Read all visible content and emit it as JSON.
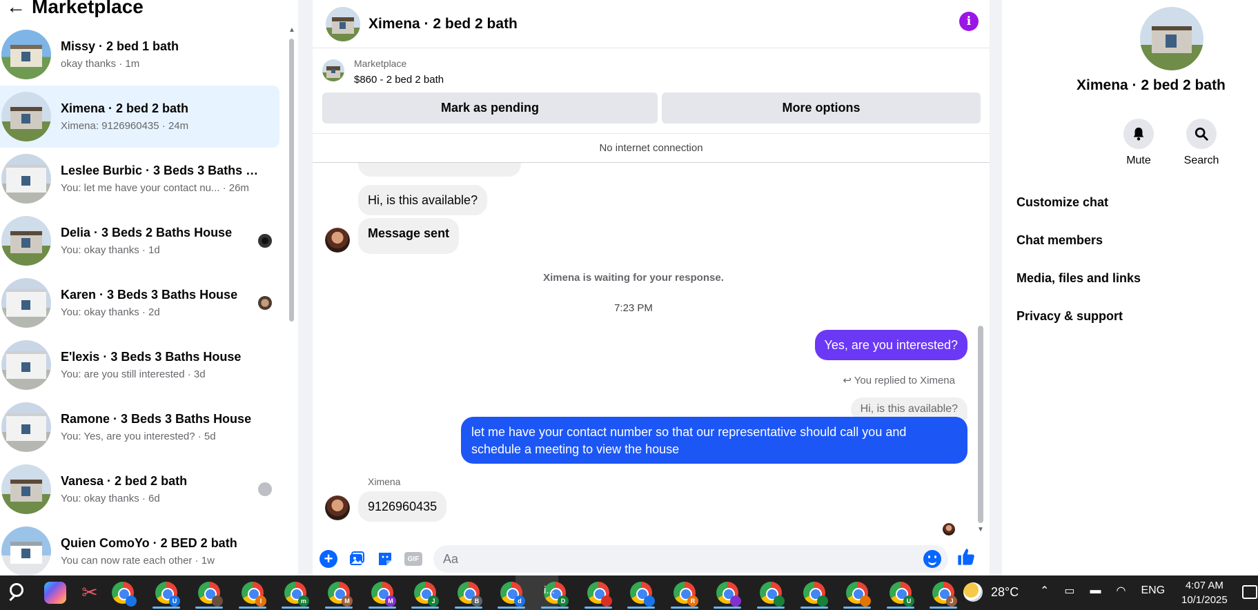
{
  "sidebar": {
    "back_glyph": "←",
    "title": "Marketplace",
    "conversations": [
      {
        "name": "Missy · 2 bed 1 bath",
        "preview": "okay thanks · 1m",
        "active": false
      },
      {
        "name": "Ximena · 2 bed 2 bath",
        "preview": "Ximena: 9126960435 · 24m",
        "active": true
      },
      {
        "name": "Leslee Burbic · 3 Beds 3 Baths H...",
        "preview": "You: let me have your contact nu... · 26m",
        "active": false
      },
      {
        "name": "Delia · 3 Beds 2 Baths House",
        "preview": "You: okay thanks · 1d",
        "active": false
      },
      {
        "name": "Karen · 3 Beds 3 Baths House",
        "preview": "You: okay thanks · 2d",
        "active": false
      },
      {
        "name": "E'lexis · 3 Beds 3 Baths House",
        "preview": "You: are you still interested · 3d",
        "active": false
      },
      {
        "name": "Ramone · 3 Beds 3 Baths House",
        "preview": "You: Yes, are you interested? · 5d",
        "active": false
      },
      {
        "name": "Vanesa · 2 bed 2 bath",
        "preview": "You: okay thanks · 6d",
        "active": false
      },
      {
        "name": "Quien ComoYo · 2 BED 2 bath",
        "preview": "You can now rate each other · 1w",
        "active": false
      }
    ]
  },
  "chat": {
    "header_title": "Ximena · 2 bed 2 bath",
    "info_glyph": "i",
    "marketplace_label": "Marketplace",
    "listing_price": "$860 - 2 bed 2 bath",
    "mark_pending": "Mark as pending",
    "more_options": "More options",
    "no_connection": "No internet connection",
    "messages": {
      "available": "Hi, is this available?",
      "sent": "Message sent",
      "waiting": "Ximena is waiting for your response.",
      "time": "7:23 PM",
      "yes": "Yes, are you interested?",
      "reply_note": "You replied to Ximena",
      "quoted": "Hi, is this available?",
      "contact_request": "let me have your contact number so that our representative should call you and schedule a meeting to view the house",
      "sender": "Ximena",
      "phone": "9126960435"
    },
    "composer_placeholder": "Aa",
    "gif_label": "GIF"
  },
  "info_panel": {
    "name": "Ximena · 2 bed 2 bath",
    "mute_label": "Mute",
    "search_label": "Search",
    "menu": [
      "Customize chat",
      "Chat members",
      "Media, files and links",
      "Privacy & support"
    ]
  },
  "taskbar": {
    "active_label": "i...",
    "weather": "28°C",
    "language": "ENG",
    "time": "4:07 AM",
    "date": "10/1/2025",
    "apps": [
      {
        "badge": "",
        "color": "#1a73e8"
      },
      {
        "badge": "U",
        "color": "#1a73e8"
      },
      {
        "badge": "",
        "color": "#6b4f3a"
      },
      {
        "badge": "I",
        "color": "#e8710a"
      },
      {
        "badge": "m",
        "color": "#188038"
      },
      {
        "badge": "M",
        "color": "#9e5d3b"
      },
      {
        "badge": "M",
        "color": "#8430ce"
      },
      {
        "badge": "J",
        "color": "#188038"
      },
      {
        "badge": "B",
        "color": "#5f6368"
      },
      {
        "badge": "d",
        "color": "#1a73e8"
      },
      {
        "badge": "D",
        "color": "#188038"
      },
      {
        "badge": "",
        "color": "#d93025"
      },
      {
        "badge": "",
        "color": "#1a73e8"
      },
      {
        "badge": "R",
        "color": "#e8710a"
      },
      {
        "badge": "",
        "color": "#8430ce"
      },
      {
        "badge": "",
        "color": "#188038"
      },
      {
        "badge": "",
        "color": "#188038"
      },
      {
        "badge": "",
        "color": "#e37400"
      },
      {
        "badge": "U",
        "color": "#188038"
      },
      {
        "badge": "J",
        "color": "#9e5d3b"
      }
    ]
  },
  "colors": {
    "accent": "#0866ff",
    "outgoing_bubble": "#1c56f5",
    "outgoing_bubble_alt": "#6b38f5",
    "info_icon": "#9b16e6",
    "active_conversation": "#e7f3ff"
  }
}
